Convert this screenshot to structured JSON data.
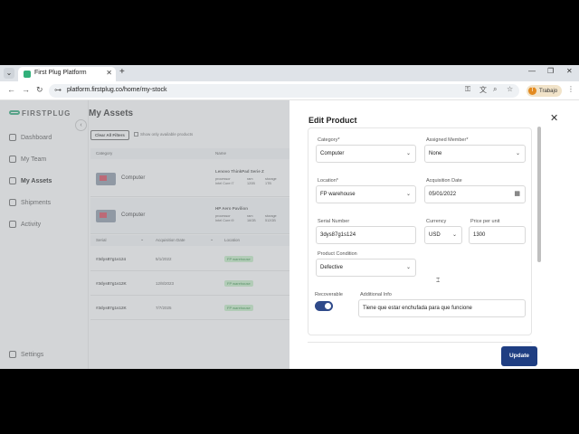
{
  "browser": {
    "tab_title": "First Plug Platform",
    "url": "platform.firstplug.co/home/my-stock",
    "profile_label": "Trabajo",
    "profile_initial": "T"
  },
  "sidebar": {
    "logo": "FIRSTPLUG",
    "items": [
      {
        "label": "Dashboard"
      },
      {
        "label": "My Team"
      },
      {
        "label": "My Assets"
      },
      {
        "label": "Shipments"
      },
      {
        "label": "Activity"
      }
    ],
    "settings": "Settings"
  },
  "assets": {
    "title": "My Assets",
    "clear_filters": "Clear All Filters",
    "show_available": "Show only available products",
    "col_category": "Category",
    "col_name": "Name",
    "rows": [
      {
        "category": "Computer",
        "name": "Lenovo ThinkPad Serie Z",
        "specs": [
          {
            "label": "processor",
            "value": "Intel Core i7"
          },
          {
            "label": "ram",
            "value": "120B"
          },
          {
            "label": "storage",
            "value": "1TB"
          }
        ]
      },
      {
        "category": "Computer",
        "name": "HP Aero Pavilion",
        "specs": [
          {
            "label": "processor",
            "value": "Intel Core i9"
          },
          {
            "label": "ram",
            "value": "16GB"
          },
          {
            "label": "storage",
            "value": "512GB"
          }
        ]
      }
    ],
    "sub_cols": {
      "serial": "Serial",
      "acq_date": "Acquisition Date",
      "location": "Location"
    },
    "sub_rows": [
      {
        "serial": "#3dys87g1s124",
        "date": "5/1/2022",
        "location": "FP warehouse"
      },
      {
        "serial": "#3dys87g1s12K",
        "date": "12/8/2023",
        "location": "FP warehouse"
      },
      {
        "serial": "#3dys87g1s12K",
        "date": "7/7/2025",
        "location": "FP warehouse"
      }
    ]
  },
  "edit_product": {
    "title": "Edit Product",
    "category_label": "Category*",
    "category_value": "Computer",
    "assigned_label": "Assigned Member*",
    "assigned_value": "None",
    "location_label": "Location*",
    "location_value": "FP warehouse",
    "acq_label": "Acquisition Date",
    "acq_value": "05/01/2022",
    "serial_label": "Serial Number",
    "serial_value": "3dys87g1s124",
    "currency_label": "Currency",
    "currency_value": "USD",
    "price_label": "Price per unit",
    "price_value": "1300",
    "condition_label": "Product Condition",
    "condition_value": "Defective",
    "recoverable_label": "Recoverable",
    "recoverable_on": true,
    "info_label": "Additional Info",
    "info_value": "Tiene que estar enchufada para que funcione",
    "update_label": "Update"
  },
  "colors": {
    "primary": "#1f3e82",
    "brand_green": "#2ea97a",
    "badge_bg": "#c7f0c8"
  }
}
